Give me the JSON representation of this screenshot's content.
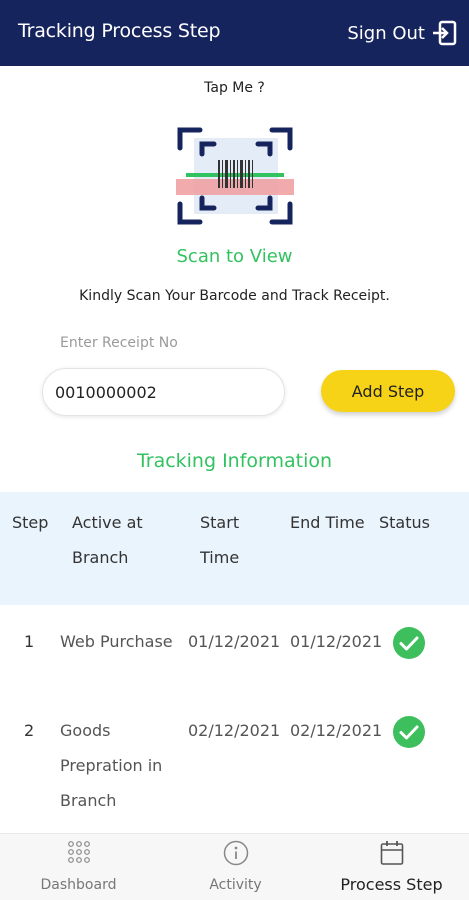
{
  "header": {
    "title": "Tracking Process Step",
    "sign_out_label": "Sign Out"
  },
  "scan": {
    "tap_label": "Tap Me ?",
    "title": "Scan to View",
    "description": "Kindly Scan Your Barcode and Track Receipt."
  },
  "receipt": {
    "label": "Enter Receipt No",
    "value": "0010000002",
    "add_button": "Add Step"
  },
  "tracking": {
    "title": "Tracking Information",
    "columns": {
      "step": "Step",
      "branch_line1": "Active at",
      "branch_line2": "Branch",
      "start_line1": "Start",
      "start_line2": "Time",
      "end": "End Time",
      "status": "Status"
    },
    "rows": [
      {
        "step": "1",
        "branch": [
          "Web Purchase"
        ],
        "start": "01/12/2021",
        "end": "01/12/2021",
        "status": "completed"
      },
      {
        "step": "2",
        "branch": [
          "Goods",
          "Prepration in",
          "Branch"
        ],
        "start": "02/12/2021",
        "end": "02/12/2021",
        "status": "completed"
      }
    ]
  },
  "nav": {
    "dashboard": "Dashboard",
    "activity": "Activity",
    "process_step": "Process Step"
  },
  "colors": {
    "header_bg": "#16245e",
    "accent_green": "#33c260",
    "button_yellow": "#f7d317",
    "table_head_bg": "#eaf4fd",
    "check_green": "#3cbf5c"
  }
}
